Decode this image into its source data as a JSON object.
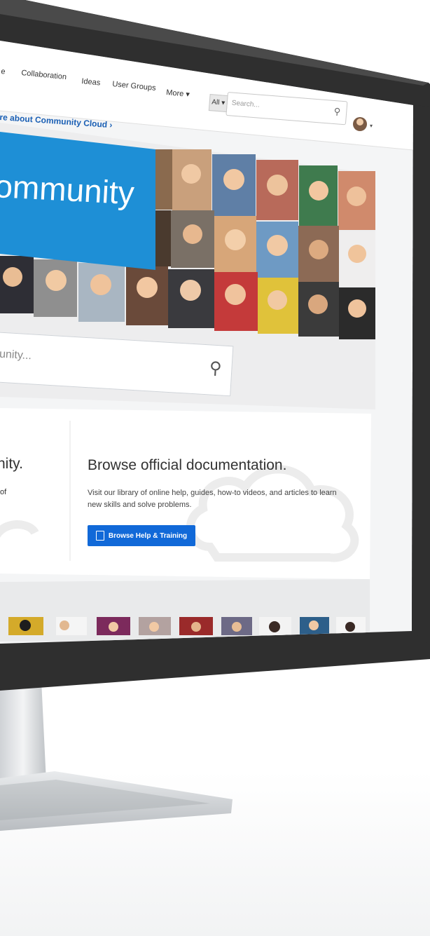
{
  "nav": {
    "items": [
      {
        "label": "e",
        "partial": true
      },
      {
        "label": "Collaboration"
      },
      {
        "label": "Ideas"
      },
      {
        "label": "User Groups"
      },
      {
        "label": "More ▾"
      }
    ]
  },
  "search": {
    "scope": "All ▾",
    "placeholder": "Search..."
  },
  "promo": {
    "text": "re about Community Cloud ›"
  },
  "hero": {
    "title": "ommunity"
  },
  "community_search": {
    "placeholder": "unity..."
  },
  "left_card": {
    "title_fragment": "nity.",
    "text_fragment": "of"
  },
  "docs": {
    "title": "Browse official documentation.",
    "description": "Visit our library of online help, guides, how-to videos, and articles to learn new skills and solve problems.",
    "button_label": "Browse Help & Training"
  },
  "colors": {
    "brand_blue": "#1e8fd6",
    "button_blue": "#1169d8",
    "bezel": "#2f2f2f"
  }
}
